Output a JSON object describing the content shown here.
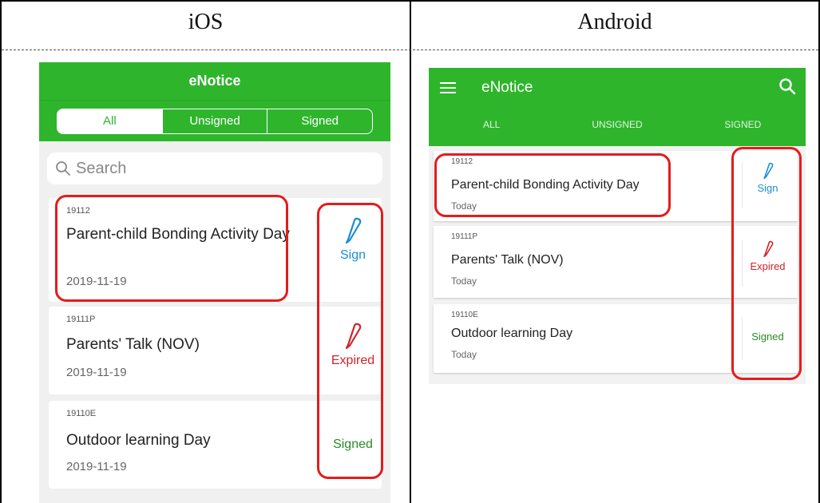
{
  "columns": {
    "ios": "iOS",
    "android": "Android"
  },
  "ios": {
    "app_title": "eNotice",
    "tabs": [
      "All",
      "Unsigned",
      "Signed"
    ],
    "active_tab": 0,
    "search_placeholder": "Search",
    "notices": [
      {
        "code": "19112",
        "title": "Parent-child Bonding Activity Day",
        "date": "2019-11-19",
        "status": "Sign"
      },
      {
        "code": "19111P",
        "title": "Parents' Talk (NOV)",
        "date": "2019-11-19",
        "status": "Expired"
      },
      {
        "code": "19110E",
        "title": "Outdoor learning Day",
        "date": "2019-11-19",
        "status": "Signed"
      }
    ]
  },
  "android": {
    "app_title": "eNotice",
    "tabs": [
      "ALL",
      "UNSIGNED",
      "SIGNED"
    ],
    "notices": [
      {
        "code": "19112",
        "title": "Parent-child Bonding Activity Day",
        "date": "Today",
        "status": "Sign"
      },
      {
        "code": "19111P",
        "title": "Parents' Talk (NOV)",
        "date": "Today",
        "status": "Expired"
      },
      {
        "code": "19110E",
        "title": "Outdoor learning Day",
        "date": "Today",
        "status": "Signed"
      }
    ]
  },
  "colors": {
    "brand_green": "#2eb52c",
    "sign_blue": "#1a8ed6",
    "expired_red": "#d0242a",
    "signed_green": "#2a8a2a",
    "annotation_red": "#e41c1c"
  }
}
